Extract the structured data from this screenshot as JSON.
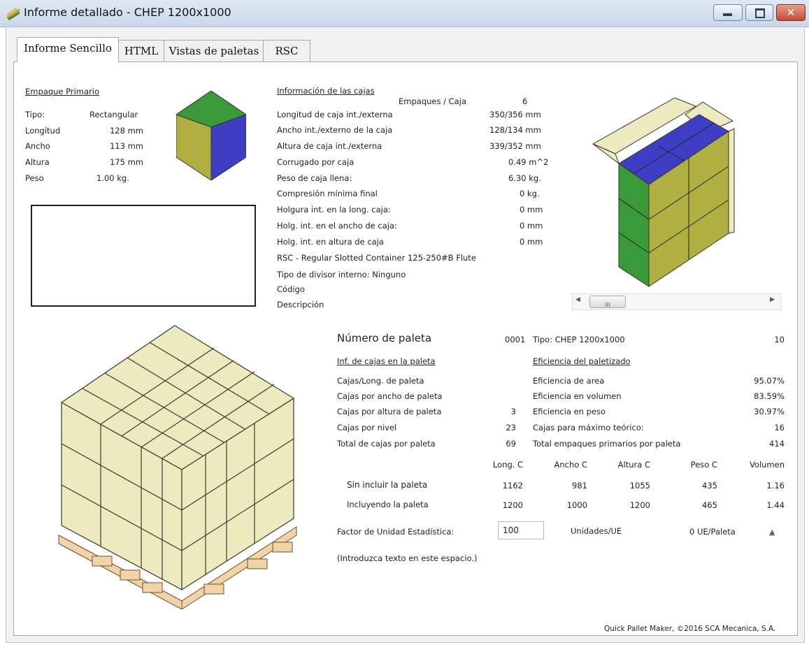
{
  "window": {
    "title": "Informe detallado - CHEP 1200x1000"
  },
  "tabs": [
    {
      "label": "Informe Sencillo",
      "active": true
    },
    {
      "label": "HTML",
      "active": false
    },
    {
      "label": "Vistas de paletas",
      "active": false
    },
    {
      "label": "RSC",
      "active": false
    }
  ],
  "primary": {
    "heading": "Empaque Primario",
    "rows": [
      {
        "label": "Tipo:",
        "value": "Rectangular"
      },
      {
        "label": "Longitud",
        "value": "128 mm"
      },
      {
        "label": "Ancho",
        "value": "113 mm"
      },
      {
        "label": "Altura",
        "value": "175 mm"
      },
      {
        "label": "Peso",
        "value": "1.00 kg."
      }
    ]
  },
  "box_info": {
    "heading": "Información de las cajas",
    "packs_label": "Empaques / Caja",
    "packs_value": "6",
    "rows": [
      {
        "label": "Longitud de caja int./externa",
        "value": "350/356 mm"
      },
      {
        "label": "Ancho int./externo de la caja",
        "value": "128/134 mm"
      },
      {
        "label": "Altura de caja int./externa",
        "value": "339/352 mm"
      },
      {
        "label": "Corrugado por caja",
        "value": "0.49 m^2"
      },
      {
        "label": "Peso de caja llena:",
        "value": "6.30 kg."
      },
      {
        "label": "Compresión mínima final",
        "value": "0 kg."
      },
      {
        "label": "Holgura int. en la long. caja:",
        "value": "0 mm"
      },
      {
        "label": "Holg. int. en el ancho de caja:",
        "value": "0 mm"
      },
      {
        "label": "Holg. int. en altura de caja",
        "value": "0 mm"
      }
    ],
    "rsc_text": "RSC - Regular Slotted Container 125-250#B Flute",
    "divider_text": "Tipo de divisor interno: Ninguno",
    "code_label": "Código",
    "desc_label": "Descripción"
  },
  "scrollbar": {
    "left_arrow": "◀",
    "thumb": "III",
    "right_arrow": "▶"
  },
  "pallet": {
    "number_label": "Número de paleta",
    "number_value": "0001",
    "type_label": "Tipo: CHEP 1200x1000",
    "type_value": "10",
    "boxes_heading": "Inf. de cajas en la paleta",
    "eff_heading": "Eficiencia del paletizado",
    "rows": [
      {
        "label": "Cajas/Long. de paleta",
        "value": "",
        "label2": "Eficiencia de area",
        "value2": "95.07%"
      },
      {
        "label": "Cajas por ancho de paleta",
        "value": "",
        "label2": "Eficiencia en volumen",
        "value2": "83.59%"
      },
      {
        "label": "Cajas por altura de paleta",
        "value": "3",
        "label2": "Eficiencia en peso",
        "value2": "30.97%"
      },
      {
        "label": "Cajas por nivel",
        "value": "23",
        "label2": "Cajas para máximo teórico:",
        "value2": "16"
      },
      {
        "label": "Total de cajas por paleta",
        "value": "69",
        "label2": "Total empaques primarios por paleta",
        "value2": "414"
      }
    ]
  },
  "dims": {
    "headers": [
      "Long. C",
      "Ancho C",
      "Altura C",
      "Peso C",
      "Volumen"
    ],
    "rows": [
      {
        "label": "Sin incluir la paleta",
        "values": [
          "1162",
          "981",
          "1055",
          "435",
          "1.16"
        ]
      },
      {
        "label": "Incluyendo la paleta",
        "values": [
          "1200",
          "1000",
          "1200",
          "465",
          "1.44"
        ]
      }
    ]
  },
  "unit_factor": {
    "label": "Factor de Unidad Estadística:",
    "value": "100",
    "units_label": "Unidades/UE",
    "per_pallet": "0 UE/Paleta",
    "hint": "(Introduzca texto en este espacio.)"
  },
  "footer": "Quick Pallet Maker, ©2016 SCA Mecanica, S.A.",
  "colors": {
    "box_face": "#eeeabf",
    "box_edge": "#3a3a2a",
    "green": "#3a9a3a",
    "blue": "#3d3ec4",
    "olive": "#b0b042",
    "pallet": "#f1d3a6"
  }
}
